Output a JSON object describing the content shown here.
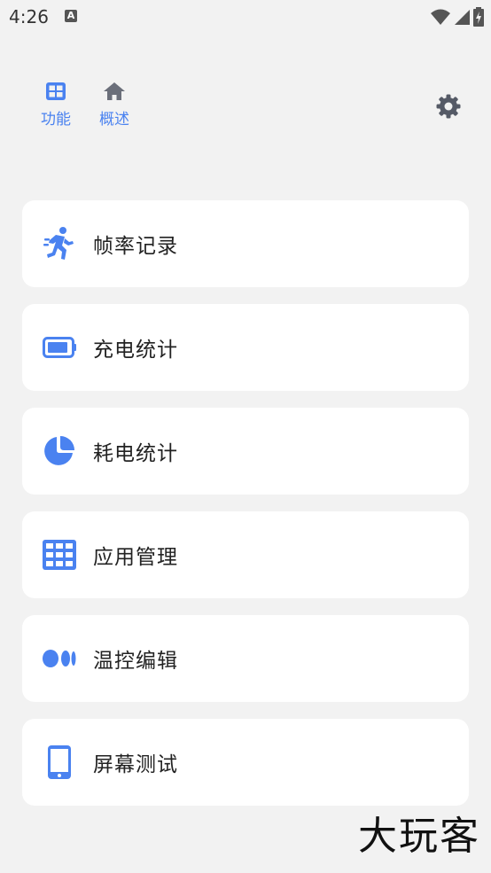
{
  "status_bar": {
    "time": "4:26",
    "notification_icon_letter": "A"
  },
  "tabs": [
    {
      "label": "功能",
      "icon": "grid-icon",
      "active": true
    },
    {
      "label": "概述",
      "icon": "home-icon",
      "active": false
    }
  ],
  "menu": {
    "items": [
      {
        "label": "帧率记录",
        "icon": "running-person-icon"
      },
      {
        "label": "充电统计",
        "icon": "battery-icon"
      },
      {
        "label": "耗电统计",
        "icon": "pie-chart-icon"
      },
      {
        "label": "应用管理",
        "icon": "apps-grid-icon"
      },
      {
        "label": "温控编辑",
        "icon": "dots-icon"
      },
      {
        "label": "屏幕测试",
        "icon": "phone-icon"
      }
    ]
  },
  "watermark": "大玩客",
  "colors": {
    "accent": "#4a82f0",
    "inactive_icon": "#6b6f7a",
    "background": "#f2f2f2",
    "card": "#ffffff",
    "text": "#222222"
  }
}
